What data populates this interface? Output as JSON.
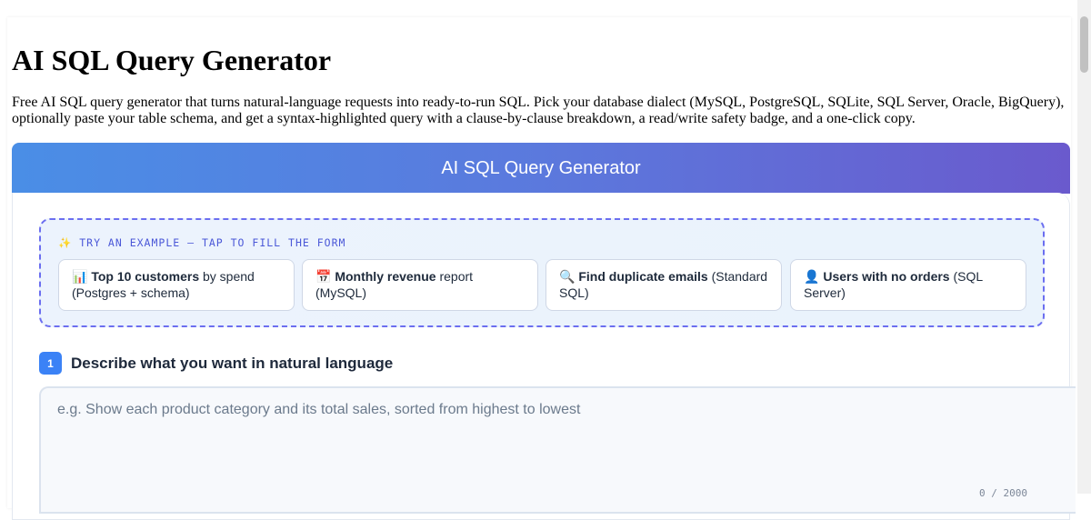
{
  "page": {
    "title": "AI SQL Query Generator",
    "intro": "Free AI SQL query generator that turns natural-language requests into ready-to-run SQL. Pick your database dialect (MySQL, PostgreSQL, SQLite, SQL Server, Oracle, BigQuery), optionally paste your table schema, and get a syntax-highlighted query with a clause-by-clause breakdown, a read/write safety badge, and a one-click copy."
  },
  "tool": {
    "header_title": "AI SQL Query Generator",
    "gradient_colors": [
      "#4a8ee6",
      "#6a5acd"
    ]
  },
  "examples": {
    "label": "✨ TRY AN EXAMPLE — TAP TO FILL THE FORM",
    "items": [
      {
        "icon": "📊",
        "icon_name": "bar-chart-icon",
        "bold": "Top 10 customers",
        "rest": " by spend (Postgres + schema)"
      },
      {
        "icon": "📅",
        "icon_name": "calendar-icon",
        "bold": "Monthly revenue",
        "rest": " report (MySQL)"
      },
      {
        "icon": "🔍",
        "icon_name": "magnifier-icon",
        "bold": "Find duplicate emails",
        "rest": " (Standard SQL)"
      },
      {
        "icon": "👤",
        "icon_name": "user-icon",
        "bold": "Users with no orders",
        "rest": " (SQL Server)"
      }
    ]
  },
  "step1": {
    "number": "1",
    "label": "Describe what you want in natural language"
  },
  "query_input": {
    "value": "",
    "placeholder": "e.g. Show each product category and its total sales, sorted from highest to lowest",
    "char_count": "0 / 2000"
  }
}
